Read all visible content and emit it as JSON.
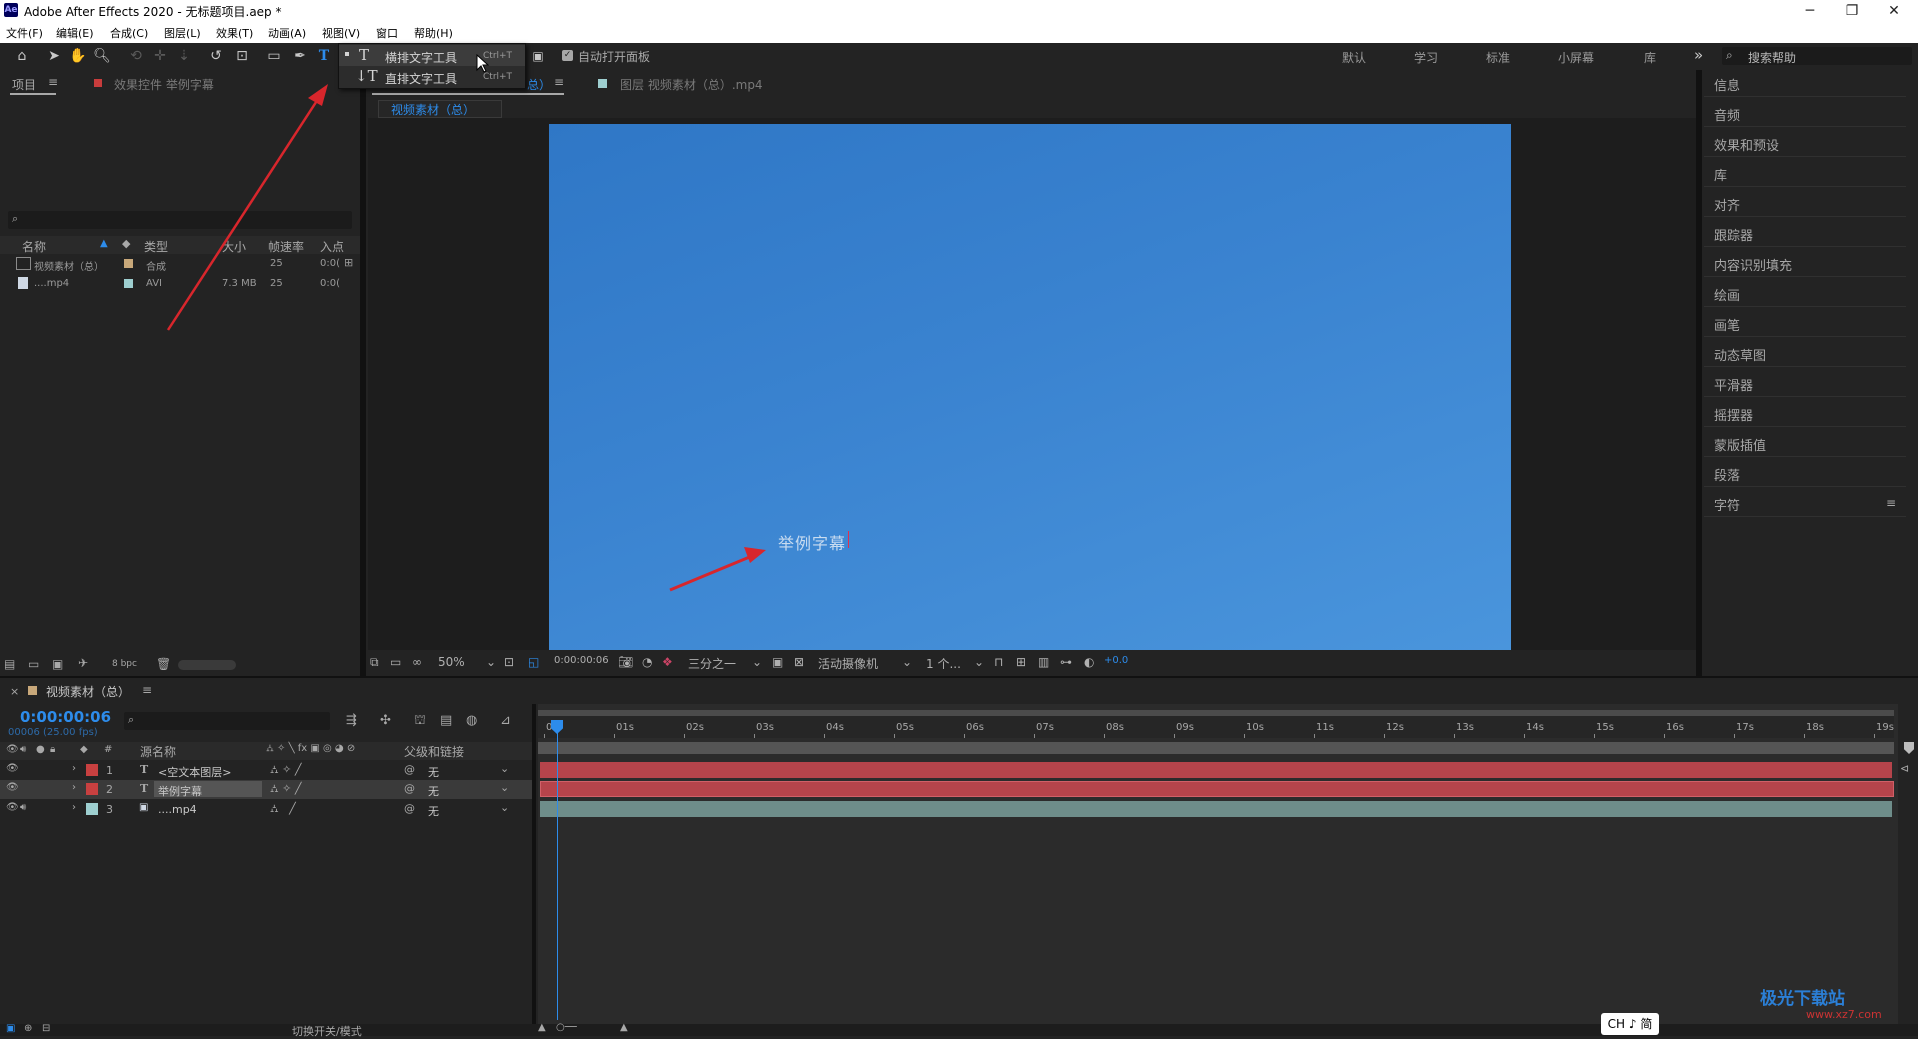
{
  "titlebar": {
    "title": "Adobe After Effects 2020 - 无标题项目.aep *",
    "app_icon": "Ae",
    "minimize": "─",
    "maximize": "❐",
    "close": "✕"
  },
  "menu": [
    "文件(F)",
    "编辑(E)",
    "合成(C)",
    "图层(L)",
    "效果(T)",
    "动画(A)",
    "视图(V)",
    "窗口",
    "帮助(H)"
  ],
  "toolbar": {
    "type_tool_glyph": "T",
    "auto_open_label": "自动打开面板",
    "workspaces": [
      "默认",
      "学习",
      "标准",
      "小屏幕",
      "库"
    ],
    "more_glyph": "»",
    "search_help": "搜索帮助"
  },
  "dropdown": {
    "items": [
      {
        "icon": "T",
        "label": "横排文字工具",
        "shortcut": "Ctrl+T"
      },
      {
        "icon": "↓T",
        "label": "直排文字工具",
        "shortcut": "Ctrl+T"
      }
    ]
  },
  "project": {
    "tab_project": "项目",
    "tab_effects": "效果控件 举例字幕",
    "columns": [
      "名称",
      "类型",
      "大小",
      "帧速率",
      "入点"
    ],
    "rows": [
      {
        "name": "视频素材（总）",
        "type": "合成",
        "size": "",
        "fps": "25",
        "in": "0:0(",
        "color": "#c8a87a"
      },
      {
        "name": "....mp4",
        "type": "AVI",
        "size": "7.3 MB",
        "fps": "25",
        "in": "0:0(",
        "color": "#9ecfd0"
      }
    ],
    "bpc": "8 bpc"
  },
  "viewer": {
    "tab_comp_suffix": "总）",
    "tab_layer": "图层 视频素材（总）.mp4",
    "comp_badge": "视频素材（总）",
    "comp_text": "举例字幕",
    "zoom": "50%",
    "timecode": "0:00:00:06",
    "resolution": "三分之一",
    "camera": "活动摄像机",
    "views": "1 个...",
    "exposure": "+0.0"
  },
  "right_panels": [
    "信息",
    "音频",
    "效果和预设",
    "库",
    "对齐",
    "跟踪器",
    "内容识别填充",
    "绘画",
    "画笔",
    "动态草图",
    "平滑器",
    "摇摆器",
    "蒙版插值",
    "段落",
    "字符"
  ],
  "timeline": {
    "comp_name": "视频素材（总）",
    "timecode": "0:00:00:06",
    "frame_info": "00006 (25.00 fps)",
    "col_source": "源名称",
    "col_parent": "父级和链接",
    "col_num": "#",
    "layers": [
      {
        "num": "1",
        "type": "T",
        "name": "<空文本图层>",
        "parent": "无",
        "color": "#c84040"
      },
      {
        "num": "2",
        "type": "T",
        "name": "举例字幕",
        "parent": "无",
        "color": "#c84040"
      },
      {
        "num": "3",
        "type": "▣",
        "name": "....mp4",
        "parent": "无",
        "color": "#9ecfd0"
      }
    ],
    "ticks": [
      "0s",
      "01s",
      "02s",
      "03s",
      "04s",
      "05s",
      "06s",
      "07s",
      "08s",
      "09s",
      "10s",
      "11s",
      "12s",
      "13s",
      "14s",
      "15s",
      "16s",
      "17s",
      "18s",
      "19s"
    ],
    "switch_mode": "切换开关/模式"
  },
  "ime": "CH ♪ 简",
  "watermark": {
    "name": "极光下载站",
    "url": "www.xz7.com"
  },
  "colors": {
    "accent": "#2d8ceb",
    "bar_red": "#b5444b",
    "bar_teal": "#6e8d8a",
    "comp_blue": "#3a83d0"
  }
}
